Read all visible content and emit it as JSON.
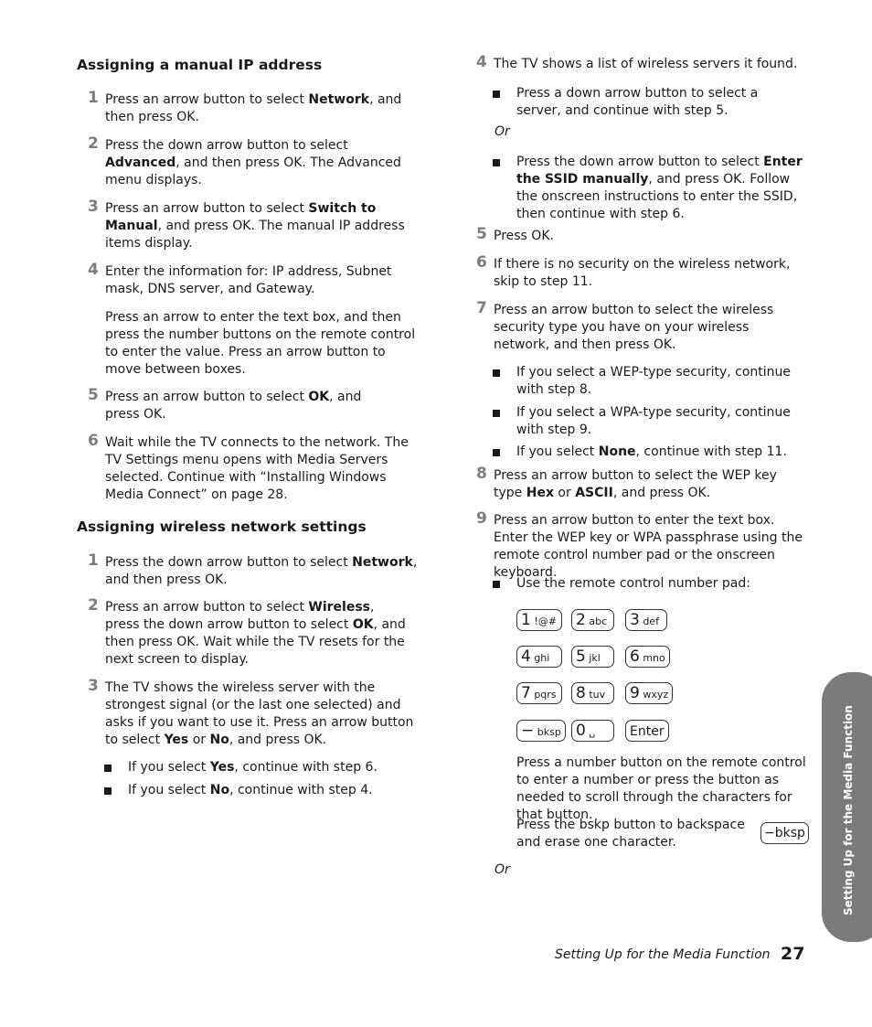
{
  "left_column": {
    "section1": {
      "heading": "Assigning a manual IP address",
      "steps": [
        {
          "num": "1",
          "parts": [
            [
              "Press an arrow button to select ",
              false
            ],
            [
              "Network",
              true
            ],
            [
              ", and then press OK.",
              false
            ]
          ]
        },
        {
          "num": "2",
          "parts": [
            [
              "Press the down arrow button to select ",
              false
            ],
            [
              "Advanced",
              true
            ],
            [
              ", and then press OK. The Advanced menu displays.",
              false
            ]
          ]
        },
        {
          "num": "3",
          "parts": [
            [
              "Press an arrow button to select ",
              false
            ],
            [
              "Switch to Manual",
              true
            ],
            [
              ", and press OK. The manual IP address items display.",
              false
            ]
          ]
        },
        {
          "num": "4",
          "parts": [
            [
              "Enter the information for: IP address, Subnet mask, DNS server, and Gateway.",
              false
            ]
          ],
          "extra": "Press an arrow to enter the text box, and then press the number buttons on the remote control to enter the value. Press an arrow button to move between boxes."
        },
        {
          "num": "5",
          "parts": [
            [
              "Press an arrow button to select ",
              false
            ],
            [
              "OK",
              true
            ],
            [
              ", and press OK.",
              false
            ]
          ]
        },
        {
          "num": "6",
          "parts": [
            [
              "Wait while the TV connects to the network. The TV Settings menu opens with Media Servers selected. Continue with “Installing Windows Media Connect” on page 28.",
              false
            ]
          ]
        }
      ]
    },
    "section2": {
      "heading": "Assigning wireless network settings",
      "steps": [
        {
          "num": "1",
          "parts": [
            [
              "Press the down arrow button to select ",
              false
            ],
            [
              "Network",
              true
            ],
            [
              ", and then press OK.",
              false
            ]
          ]
        },
        {
          "num": "2",
          "parts": [
            [
              "Press an arrow button to select ",
              false
            ],
            [
              "Wireless",
              true
            ],
            [
              ", press the down arrow button to select ",
              false
            ],
            [
              "OK",
              true
            ],
            [
              ", and then press OK. Wait while the TV resets for the next screen to display.",
              false
            ]
          ]
        },
        {
          "num": "3",
          "parts": [
            [
              "The TV shows the wireless server with the strongest signal (or the last one selected) and asks if you want to use it. Press an arrow button to select ",
              false
            ],
            [
              "Yes",
              true
            ],
            [
              " or ",
              false
            ],
            [
              "No",
              true
            ],
            [
              ", and press OK.",
              false
            ]
          ]
        }
      ],
      "bullets": [
        [
          [
            "If you select ",
            false
          ],
          [
            "Yes",
            true
          ],
          [
            ", continue with step 6.",
            false
          ]
        ],
        [
          [
            "If you select ",
            false
          ],
          [
            "No",
            true
          ],
          [
            ", continue with step 4.",
            false
          ]
        ]
      ]
    }
  },
  "right_column": {
    "step4": {
      "num": "4",
      "text": "The TV shows a list of wireless servers it found."
    },
    "step4_bullet1": [
      [
        "Press a down arrow button to select a server, and continue with step 5.",
        false
      ]
    ],
    "or_label": "Or",
    "step4_bullet2": [
      [
        "Press the down arrow button to select ",
        false
      ],
      [
        "Enter the SSID manually",
        true
      ],
      [
        ", and press OK. Follow the onscreen instructions to enter the SSID, then continue with step 6.",
        false
      ]
    ],
    "step5": {
      "num": "5",
      "text": "Press OK."
    },
    "step6": {
      "num": "6",
      "text": "If there is no security on the wireless network, skip to step 11."
    },
    "step7": {
      "num": "7",
      "text": "Press an arrow button to select the wireless security type you have on your wireless network, and then press OK."
    },
    "step7_bullets": [
      [
        [
          "If you select a WEP-type security, continue with step 8.",
          false
        ]
      ],
      [
        [
          "If you select a WPA-type security, continue with step 9.",
          false
        ]
      ],
      [
        [
          "If you select ",
          false
        ],
        [
          "None",
          true
        ],
        [
          ", continue with step 11.",
          false
        ]
      ]
    ],
    "step8": {
      "num": "8",
      "parts": [
        [
          "Press an arrow button to select the WEP key type ",
          false
        ],
        [
          "Hex",
          true
        ],
        [
          " or ",
          false
        ],
        [
          "ASCII",
          true
        ],
        [
          ", and press OK.",
          false
        ]
      ]
    },
    "step9": {
      "num": "9",
      "text": "Press an arrow button to enter the text box. Enter the WEP key or WPA passphrase using the remote control number pad or the onscreen keyboard."
    },
    "step9_bullet": "Use the remote control number pad:",
    "keypad": [
      {
        "main": "1",
        "sub": "!@#"
      },
      {
        "main": "2",
        "sub": "abc"
      },
      {
        "main": "3",
        "sub": "def"
      },
      {
        "main": "4",
        "sub": "ghi"
      },
      {
        "main": "5",
        "sub": "jkl"
      },
      {
        "main": "6",
        "sub": "mno"
      },
      {
        "main": "7",
        "sub": "pqrs"
      },
      {
        "main": "8",
        "sub": "tuv"
      },
      {
        "main": "9",
        "sub": "wxyz"
      },
      {
        "main": "−",
        "sub": "bksp"
      },
      {
        "main": "0",
        "sub": "␣"
      },
      {
        "main": "Enter",
        "sub": ""
      }
    ],
    "keypad_note": "Press a number button on the remote control to enter a number or press the button as needed to scroll through the characters for that button.",
    "bksp_note": "Press the bskp button to backspace and erase one character.",
    "bksp_key": {
      "main": "−",
      "sub": "bksp"
    },
    "or_label_2": "Or"
  },
  "side_tab": {
    "label": "Setting Up for the Media Function",
    "color": "#7b7b7b"
  },
  "footer": {
    "title": "Setting Up for the Media Function",
    "page_number": "27"
  }
}
